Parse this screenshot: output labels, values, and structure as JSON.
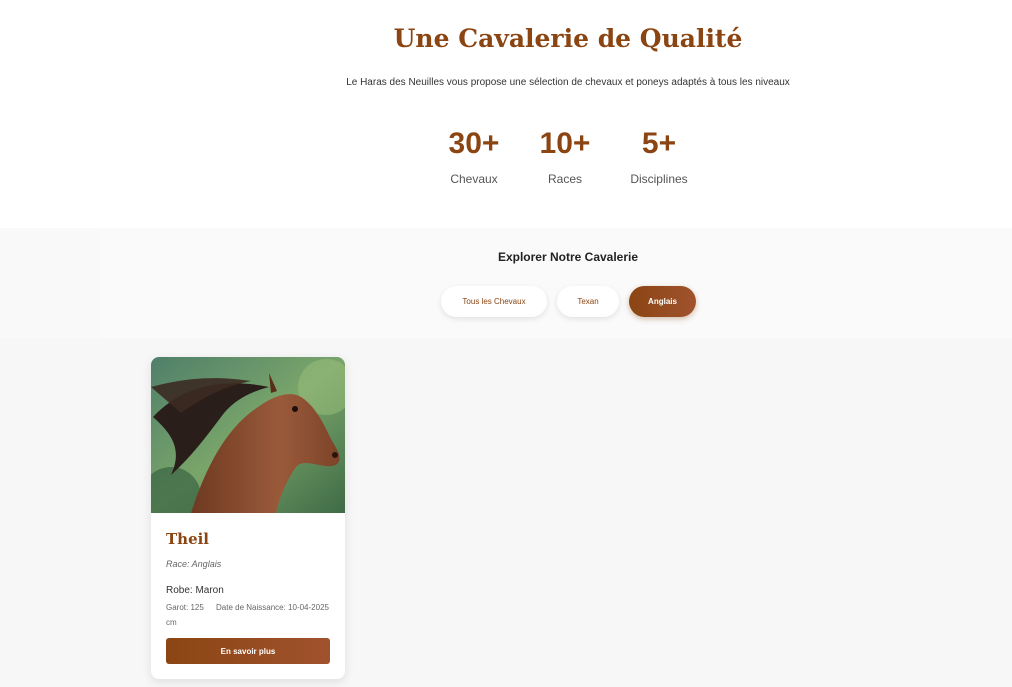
{
  "hero": {
    "title": "Une Cavalerie de Qualité",
    "subtitle": "Le Haras des Neuilles vous propose une sélection de chevaux et poneys adaptés à tous les niveaux"
  },
  "stats": [
    {
      "value": "30+",
      "label": "Chevaux"
    },
    {
      "value": "10+",
      "label": "Races"
    },
    {
      "value": "5+",
      "label": "Disciplines"
    }
  ],
  "filters": {
    "title": "Explorer Notre Cavalerie",
    "options": [
      {
        "label": "Tous les Chevaux",
        "active": false
      },
      {
        "label": "Texan",
        "active": false
      },
      {
        "label": "Anglais",
        "active": true
      }
    ]
  },
  "horses": [
    {
      "name": "Theil",
      "race": "Race: Anglais",
      "robe": "Robe: Maron",
      "garot": "Garot: 125 cm",
      "naissance": "Date de Naissance: 10-04-2025",
      "button": "En savoir plus",
      "photo_icon": "horse-photo"
    }
  ],
  "colors": {
    "accent": "#8b4513",
    "accent_light": "#a0522d",
    "section_bg": "#f7f7f7"
  }
}
